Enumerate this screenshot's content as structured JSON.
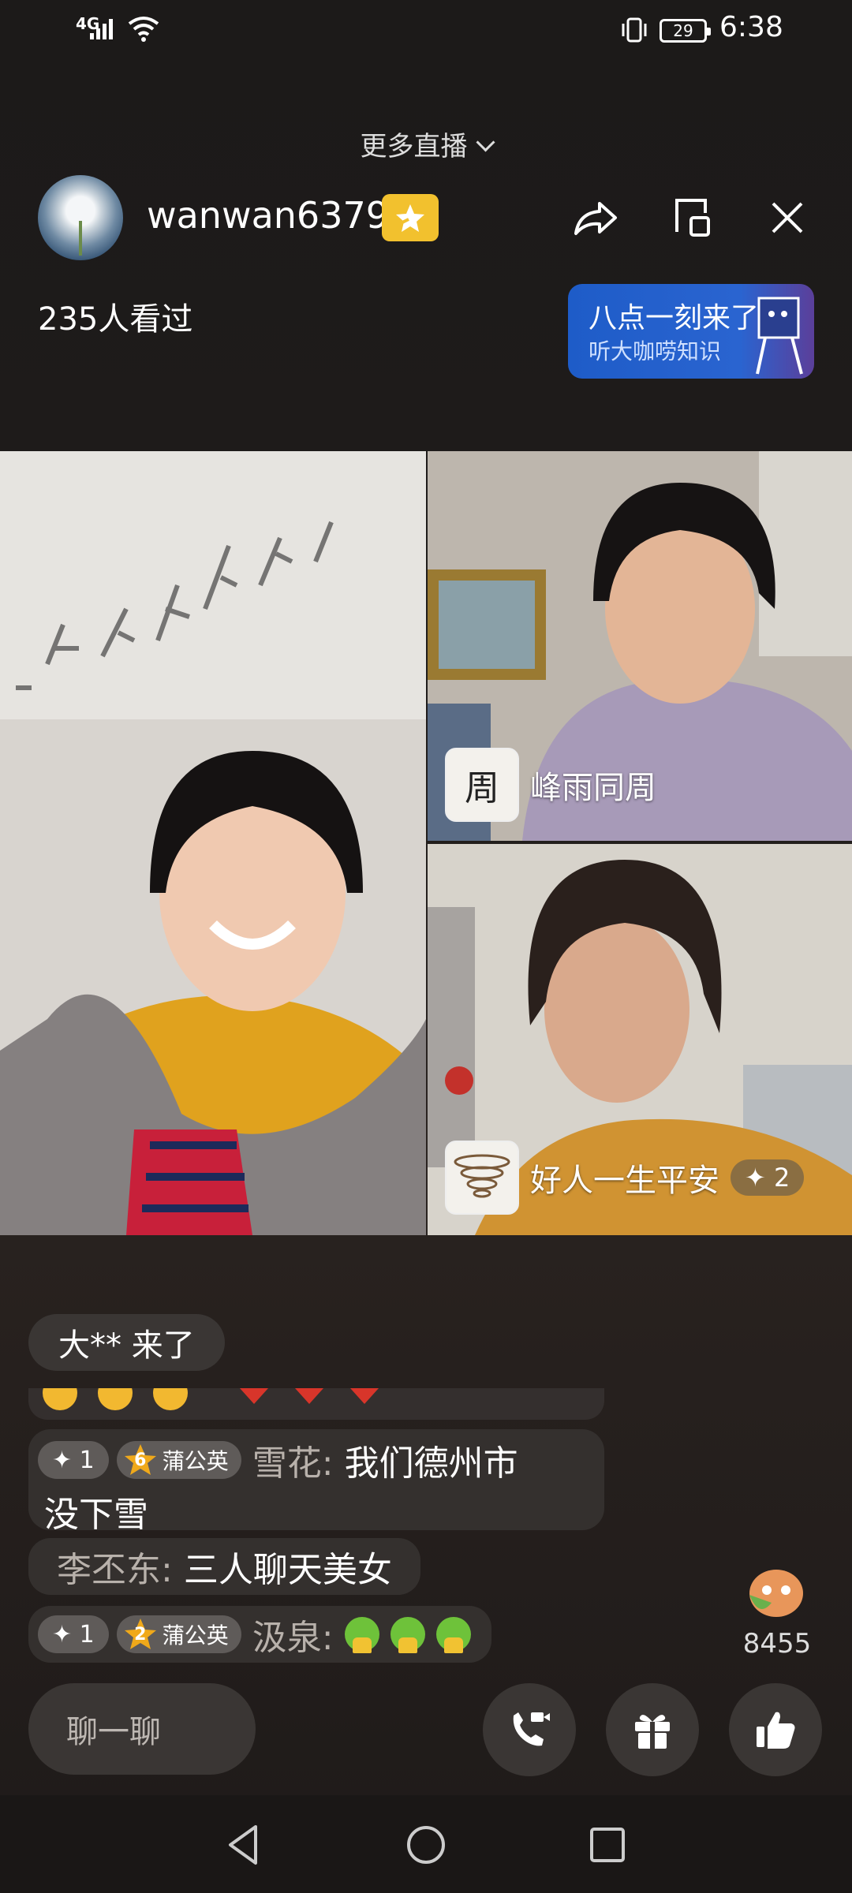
{
  "status_bar": {
    "network": "4G",
    "battery": "29",
    "time": "6:38"
  },
  "header": {
    "more_live": "更多直播",
    "username": "wanwan6379",
    "viewers": "235人看过"
  },
  "promo": {
    "title": "八点一刻来了",
    "subtitle": "听大咖唠知识"
  },
  "video_tiles": {
    "top_right": {
      "avatar_char": "周",
      "name": "峰雨同周"
    },
    "bottom_right": {
      "name": "好人一生平安",
      "count": "✦ 2"
    }
  },
  "chat": {
    "join_notice": "大** 来了",
    "messages": [
      {
        "plus": "✦ 1",
        "level": "6",
        "badge": "蒲公英",
        "name": "雪花:",
        "text_line1": "我们德州市",
        "text_line2": "没下雪"
      },
      {
        "name": "李丕东:",
        "text": "三人聊天美女"
      },
      {
        "plus": "✦ 1",
        "level": "2",
        "badge": "蒲公英",
        "name": "汲泉:"
      }
    ]
  },
  "likes": {
    "count": "8455"
  },
  "bottom_bar": {
    "chat_placeholder": "聊一聊"
  },
  "colors": {
    "accent_gold": "#f2c12e",
    "promo_blue": "#1e5cc8"
  }
}
